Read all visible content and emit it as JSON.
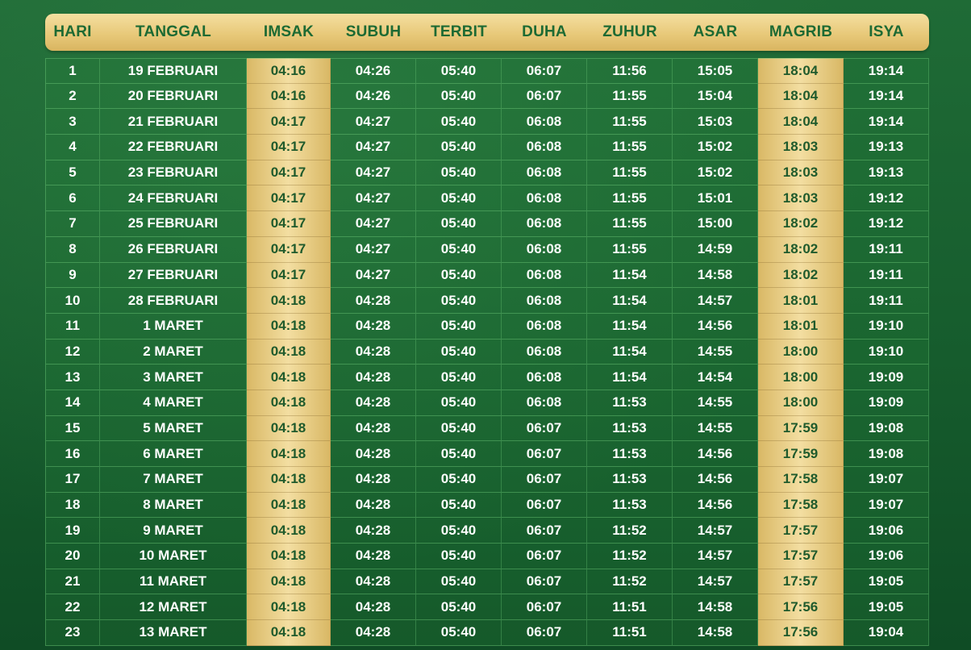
{
  "header": {
    "columns": [
      "HARI",
      "TANGGAL",
      "IMSAK",
      "SUBUH",
      "TERBIT",
      "DUHA",
      "ZUHUR",
      "ASAR",
      "MAGRIB",
      "ISYA"
    ]
  },
  "colors": {
    "background_green": "#165c2d",
    "gold": "#e8c97a",
    "header_text": "#1d6a33",
    "cell_text": "#ffffff"
  },
  "rows": [
    [
      "1",
      "19 FEBRUARI",
      "04:16",
      "04:26",
      "05:40",
      "06:07",
      "11:56",
      "15:05",
      "18:04",
      "19:14"
    ],
    [
      "2",
      "20 FEBRUARI",
      "04:16",
      "04:26",
      "05:40",
      "06:07",
      "11:55",
      "15:04",
      "18:04",
      "19:14"
    ],
    [
      "3",
      "21 FEBRUARI",
      "04:17",
      "04:27",
      "05:40",
      "06:08",
      "11:55",
      "15:03",
      "18:04",
      "19:14"
    ],
    [
      "4",
      "22 FEBRUARI",
      "04:17",
      "04:27",
      "05:40",
      "06:08",
      "11:55",
      "15:02",
      "18:03",
      "19:13"
    ],
    [
      "5",
      "23 FEBRUARI",
      "04:17",
      "04:27",
      "05:40",
      "06:08",
      "11:55",
      "15:02",
      "18:03",
      "19:13"
    ],
    [
      "6",
      "24 FEBRUARI",
      "04:17",
      "04:27",
      "05:40",
      "06:08",
      "11:55",
      "15:01",
      "18:03",
      "19:12"
    ],
    [
      "7",
      "25 FEBRUARI",
      "04:17",
      "04:27",
      "05:40",
      "06:08",
      "11:55",
      "15:00",
      "18:02",
      "19:12"
    ],
    [
      "8",
      "26 FEBRUARI",
      "04:17",
      "04:27",
      "05:40",
      "06:08",
      "11:55",
      "14:59",
      "18:02",
      "19:11"
    ],
    [
      "9",
      "27 FEBRUARI",
      "04:17",
      "04:27",
      "05:40",
      "06:08",
      "11:54",
      "14:58",
      "18:02",
      "19:11"
    ],
    [
      "10",
      "28 FEBRUARI",
      "04:18",
      "04:28",
      "05:40",
      "06:08",
      "11:54",
      "14:57",
      "18:01",
      "19:11"
    ],
    [
      "11",
      "1 MARET",
      "04:18",
      "04:28",
      "05:40",
      "06:08",
      "11:54",
      "14:56",
      "18:01",
      "19:10"
    ],
    [
      "12",
      "2 MARET",
      "04:18",
      "04:28",
      "05:40",
      "06:08",
      "11:54",
      "14:55",
      "18:00",
      "19:10"
    ],
    [
      "13",
      "3 MARET",
      "04:18",
      "04:28",
      "05:40",
      "06:08",
      "11:54",
      "14:54",
      "18:00",
      "19:09"
    ],
    [
      "14",
      "4 MARET",
      "04:18",
      "04:28",
      "05:40",
      "06:08",
      "11:53",
      "14:55",
      "18:00",
      "19:09"
    ],
    [
      "15",
      "5 MARET",
      "04:18",
      "04:28",
      "05:40",
      "06:07",
      "11:53",
      "14:55",
      "17:59",
      "19:08"
    ],
    [
      "16",
      "6 MARET",
      "04:18",
      "04:28",
      "05:40",
      "06:07",
      "11:53",
      "14:56",
      "17:59",
      "19:08"
    ],
    [
      "17",
      "7 MARET",
      "04:18",
      "04:28",
      "05:40",
      "06:07",
      "11:53",
      "14:56",
      "17:58",
      "19:07"
    ],
    [
      "18",
      "8 MARET",
      "04:18",
      "04:28",
      "05:40",
      "06:07",
      "11:53",
      "14:56",
      "17:58",
      "19:07"
    ],
    [
      "19",
      "9 MARET",
      "04:18",
      "04:28",
      "05:40",
      "06:07",
      "11:52",
      "14:57",
      "17:57",
      "19:06"
    ],
    [
      "20",
      "10 MARET",
      "04:18",
      "04:28",
      "05:40",
      "06:07",
      "11:52",
      "14:57",
      "17:57",
      "19:06"
    ],
    [
      "21",
      "11 MARET",
      "04:18",
      "04:28",
      "05:40",
      "06:07",
      "11:52",
      "14:57",
      "17:57",
      "19:05"
    ],
    [
      "22",
      "12 MARET",
      "04:18",
      "04:28",
      "05:40",
      "06:07",
      "11:51",
      "14:58",
      "17:56",
      "19:05"
    ],
    [
      "23",
      "13 MARET",
      "04:18",
      "04:28",
      "05:40",
      "06:07",
      "11:51",
      "14:58",
      "17:56",
      "19:04"
    ]
  ]
}
